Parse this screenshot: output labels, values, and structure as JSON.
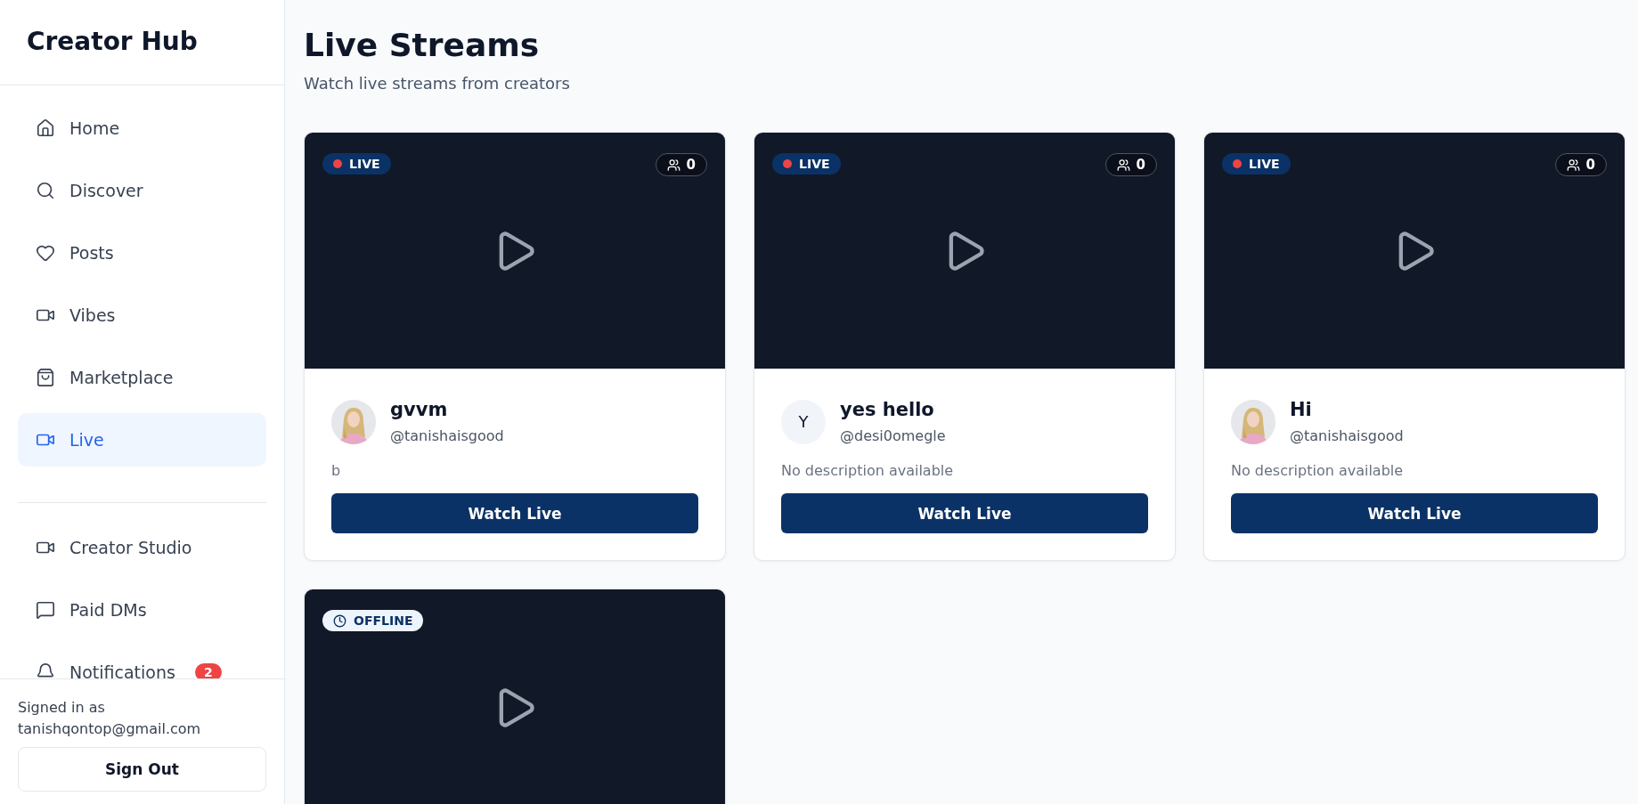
{
  "sidebar": {
    "brand": "Creator Hub",
    "items": [
      {
        "label": "Home",
        "selected": false
      },
      {
        "label": "Discover",
        "selected": false
      },
      {
        "label": "Posts",
        "selected": false
      },
      {
        "label": "Vibes",
        "selected": false
      },
      {
        "label": "Marketplace",
        "selected": false
      },
      {
        "label": "Live",
        "selected": true
      }
    ],
    "secondary_items": [
      {
        "label": "Creator Studio",
        "selected": false
      },
      {
        "label": "Paid DMs",
        "selected": false
      },
      {
        "label": "Notifications",
        "selected": false,
        "badge": "2"
      }
    ],
    "account": {
      "caption": "Signed in as",
      "email": "tanishqontop@gmail.com",
      "button": "Sign Out"
    }
  },
  "page": {
    "title": "Live Streams",
    "subtitle": "Watch live streams from creators"
  },
  "streams": [
    {
      "kind": "live",
      "status_label": "LIVE",
      "viewers": "0",
      "title": "gvvm",
      "handle": "@tanishaisgood",
      "description": "b",
      "button": "Watch Live"
    },
    {
      "kind": "live",
      "status_label": "LIVE",
      "viewers": "0",
      "title": "yes hello",
      "handle": "@desi0omegle",
      "avatar": {
        "kind": "initial",
        "text": "Y"
      },
      "description": "No description available",
      "button": "Watch Live"
    },
    {
      "kind": "live",
      "status_label": "LIVE",
      "viewers": "0",
      "title": "Hi",
      "handle": "@tanishaisgood",
      "description": "No description available",
      "button": "Watch Live"
    },
    {
      "kind": "offline",
      "status_label": "OFFLINE"
    }
  ]
}
